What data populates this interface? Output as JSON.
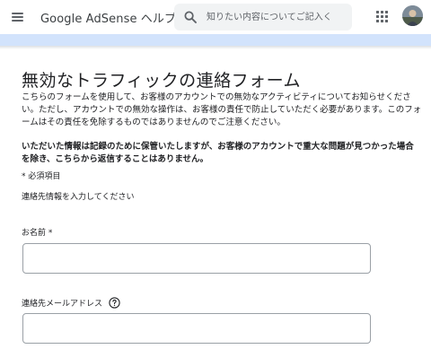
{
  "header": {
    "app_title": "Google AdSense ヘルプ",
    "search_placeholder": "知りたい内容についてご記入く",
    "icons": [
      "menu-icon",
      "search-icon",
      "apps-icon",
      "avatar"
    ]
  },
  "colors": {
    "band": "#d2e3fc",
    "search_bg": "#f1f3f4",
    "icon_gray": "#5f6368",
    "field_border": "#9aa0a6"
  },
  "form": {
    "title": "無効なトラフィックの連絡フォーム",
    "intro": "こちらのフォームを使用して、お客様のアカウントでの無効なアクティビティについてお知らせください。ただし、アカウントでの無効な操作は、お客様の責任で防止していただく必要があります。このフォームはその責任を免除するものではありませんのでご注意ください。",
    "notice": "いただいた情報は記録のために保管いたしますが、お客様のアカウントで重大な問題が見つかった場合を除き、こちらから返信することはありません。",
    "required_note": "* 必須項目",
    "section_heading": "連絡先情報を入力してください",
    "fields": {
      "name": {
        "label": "お名前 *",
        "value": ""
      },
      "email": {
        "label": "連絡先メールアドレス",
        "value": ""
      }
    }
  }
}
